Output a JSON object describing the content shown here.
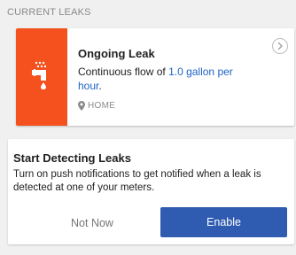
{
  "section": {
    "header": "CURRENT LEAKS"
  },
  "leak_card": {
    "icon": "faucet-drip-icon",
    "title": "Ongoing Leak",
    "description_prefix": "Continuous flow of ",
    "description_highlight": "1.0 gallon per hour",
    "description_suffix": ".",
    "location": "HOME",
    "location_icon": "map-pin-icon",
    "action_icon": "chevron-right-circle-icon"
  },
  "detect_card": {
    "title": "Start Detecting Leaks",
    "description": "Turn on push notifications to get notified when a leak is detected at one of your meters.",
    "secondary_button": "Not Now",
    "primary_button": "Enable"
  },
  "colors": {
    "alert": "#f4511e",
    "accent": "#1e63c4",
    "primary_button": "#2f5cb0",
    "muted_text": "#8a8a8a",
    "background": "#f0f0f0"
  }
}
